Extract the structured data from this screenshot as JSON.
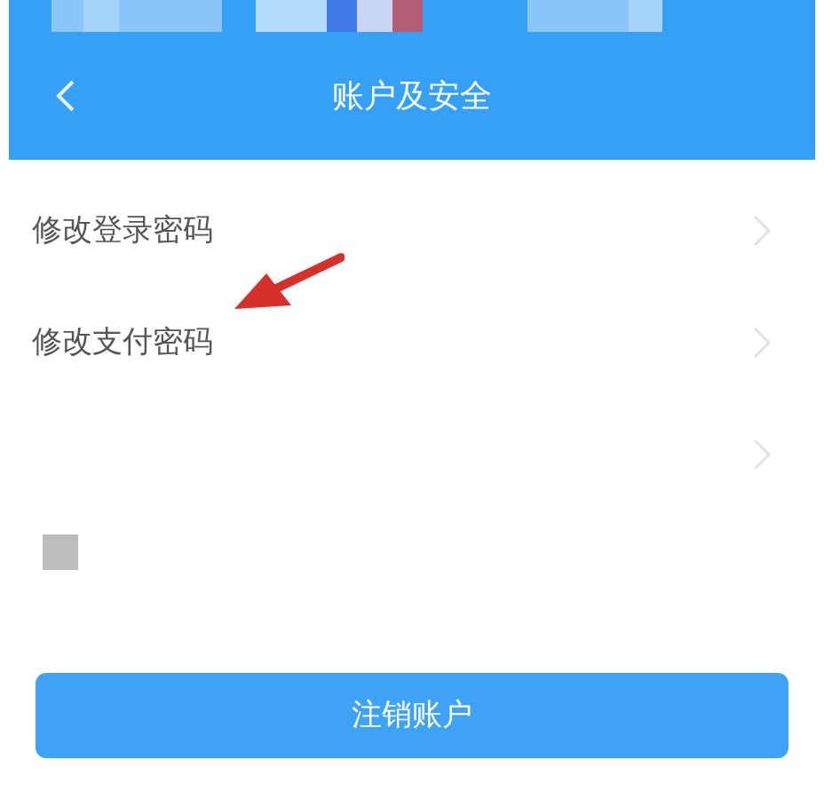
{
  "nav_bar": {
    "title": "账户及安全"
  },
  "menu_items": [
    {
      "kind": "labeled",
      "label": "修改登录密码"
    },
    {
      "kind": "labeled",
      "label": "修改支付密码"
    },
    {
      "kind": "blank"
    }
  ],
  "primary_button": {
    "label": "注销账户"
  }
}
